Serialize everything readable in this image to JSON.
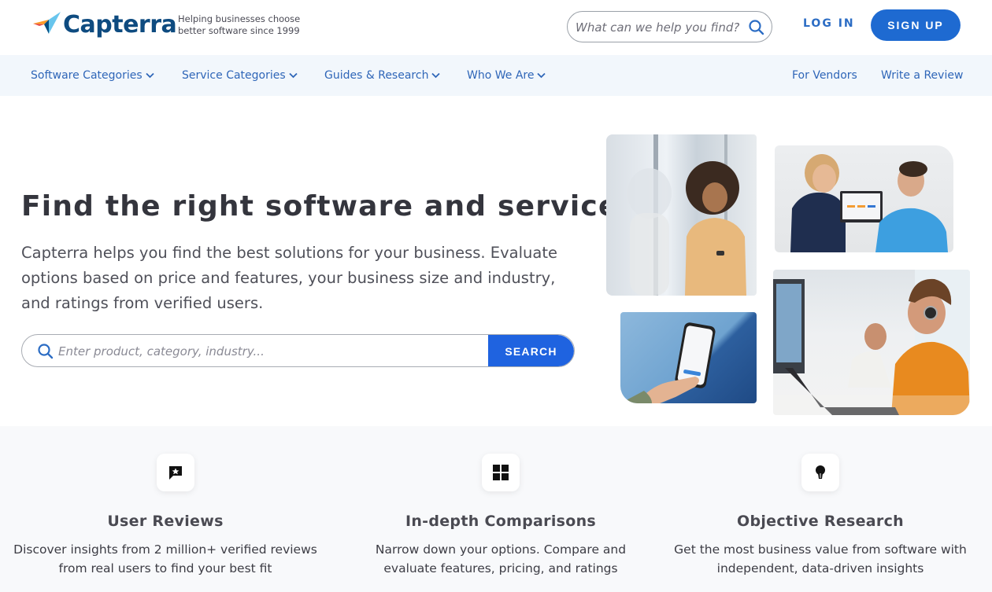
{
  "header": {
    "brand": "Capterra",
    "tagline_line1": "Helping businesses choose",
    "tagline_line2": "better software since 1999",
    "search_placeholder": "What can we help you find?",
    "login_label": "LOG IN",
    "signup_label": "SIGN UP"
  },
  "nav": {
    "left_items": [
      {
        "label": "Software Categories",
        "has_dropdown": true
      },
      {
        "label": "Service Categories",
        "has_dropdown": true
      },
      {
        "label": "Guides & Research",
        "has_dropdown": true
      },
      {
        "label": "Who We Are",
        "has_dropdown": true
      }
    ],
    "right_items": [
      {
        "label": "For Vendors"
      },
      {
        "label": "Write a Review"
      }
    ]
  },
  "hero": {
    "title": "Find the right software and services",
    "subtitle": "Capterra helps you find the best solutions for your business. Evaluate options based on price and features, your business size and industry, and ratings from verified users.",
    "search_placeholder": "Enter product, category, industry...",
    "search_button": "SEARCH",
    "photos": [
      {
        "alt": "Woman smiling while using a smartphone by a window"
      },
      {
        "alt": "Two colleagues discussing over a laptop"
      },
      {
        "alt": "Hand holding a phone showing the Capterra app"
      },
      {
        "alt": "Man with headset working on a laptop in an office"
      }
    ]
  },
  "features": [
    {
      "icon": "chat-star-icon",
      "title": "User Reviews",
      "desc_line1": "Discover insights from 2 million+ verified reviews",
      "desc_line2": "from real users to find your best fit"
    },
    {
      "icon": "grid-icon",
      "title": "In-depth Comparisons",
      "desc_line1": "Narrow down your options. Compare and",
      "desc_line2": "evaluate features, pricing, and ratings"
    },
    {
      "icon": "lightbulb-icon",
      "title": "Objective Research",
      "desc_line1": "Get the most business value from software with",
      "desc_line2": "independent, data-driven insights"
    }
  ],
  "colors": {
    "brand_navy": "#0e4b80",
    "primary_blue": "#1e6ad1",
    "search_blue": "#1f63e0",
    "nav_link": "#2f66b8",
    "nav_bg": "#f2f7fc"
  }
}
